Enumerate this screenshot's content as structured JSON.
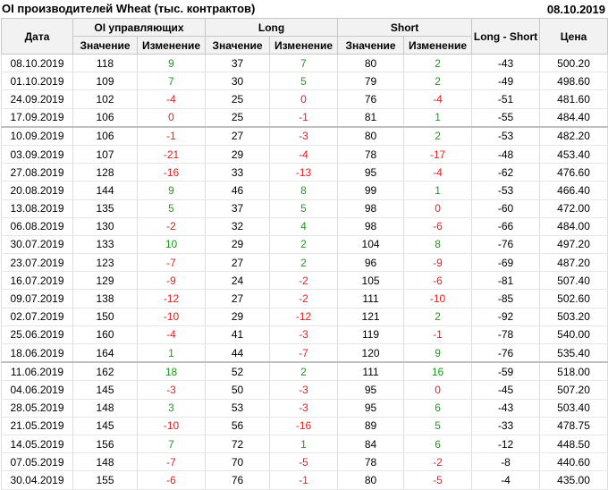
{
  "title": "OI производителей Wheat (тыс. контрактов)",
  "date": "08.10.2019",
  "headers": {
    "date": "Дата",
    "oi": "OI управляющих",
    "long": "Long",
    "short": "Short",
    "ls": "Long - Short",
    "price": "Цена",
    "value": "Значение",
    "change": "Изменение"
  },
  "colors": {
    "positive": "#1c9a1c",
    "negative": "#e02020"
  },
  "rows": [
    {
      "date": "08.10.2019",
      "oi": "118",
      "oi_ch": "9",
      "long": "37",
      "long_ch": "7",
      "short": "80",
      "short_ch": "2",
      "ls": "-43",
      "price": "500.20"
    },
    {
      "date": "01.10.2019",
      "oi": "109",
      "oi_ch": "7",
      "long": "30",
      "long_ch": "5",
      "short": "79",
      "short_ch": "2",
      "ls": "-49",
      "price": "498.60"
    },
    {
      "date": "24.09.2019",
      "oi": "102",
      "oi_ch": "-4",
      "long": "25",
      "long_ch": "0",
      "short": "76",
      "short_ch": "-4",
      "ls": "-51",
      "price": "481.60"
    },
    {
      "date": "17.09.2019",
      "oi": "106",
      "oi_ch": "0",
      "long": "25",
      "long_ch": "-1",
      "short": "81",
      "short_ch": "1",
      "ls": "-55",
      "price": "484.40"
    },
    {
      "date": "10.09.2019",
      "oi": "106",
      "oi_ch": "-1",
      "long": "27",
      "long_ch": "-3",
      "short": "80",
      "short_ch": "2",
      "ls": "-53",
      "price": "482.20",
      "sep": true
    },
    {
      "date": "03.09.2019",
      "oi": "107",
      "oi_ch": "-21",
      "long": "29",
      "long_ch": "-4",
      "short": "78",
      "short_ch": "-17",
      "ls": "-48",
      "price": "453.40"
    },
    {
      "date": "27.08.2019",
      "oi": "128",
      "oi_ch": "-16",
      "long": "33",
      "long_ch": "-13",
      "short": "95",
      "short_ch": "-4",
      "ls": "-62",
      "price": "476.60"
    },
    {
      "date": "20.08.2019",
      "oi": "144",
      "oi_ch": "9",
      "long": "46",
      "long_ch": "8",
      "short": "99",
      "short_ch": "1",
      "ls": "-53",
      "price": "466.40"
    },
    {
      "date": "13.08.2019",
      "oi": "135",
      "oi_ch": "5",
      "long": "37",
      "long_ch": "5",
      "short": "98",
      "short_ch": "0",
      "ls": "-60",
      "price": "472.00"
    },
    {
      "date": "06.08.2019",
      "oi": "130",
      "oi_ch": "-2",
      "long": "32",
      "long_ch": "4",
      "short": "98",
      "short_ch": "-6",
      "ls": "-66",
      "price": "484.00"
    },
    {
      "date": "30.07.2019",
      "oi": "133",
      "oi_ch": "10",
      "long": "29",
      "long_ch": "2",
      "short": "104",
      "short_ch": "8",
      "ls": "-76",
      "price": "497.20"
    },
    {
      "date": "23.07.2019",
      "oi": "123",
      "oi_ch": "-7",
      "long": "27",
      "long_ch": "2",
      "short": "96",
      "short_ch": "-9",
      "ls": "-69",
      "price": "487.20"
    },
    {
      "date": "16.07.2019",
      "oi": "129",
      "oi_ch": "-9",
      "long": "24",
      "long_ch": "-2",
      "short": "105",
      "short_ch": "-6",
      "ls": "-81",
      "price": "507.40"
    },
    {
      "date": "09.07.2019",
      "oi": "138",
      "oi_ch": "-12",
      "long": "27",
      "long_ch": "-2",
      "short": "111",
      "short_ch": "-10",
      "ls": "-85",
      "price": "502.60"
    },
    {
      "date": "02.07.2019",
      "oi": "150",
      "oi_ch": "-10",
      "long": "29",
      "long_ch": "-12",
      "short": "121",
      "short_ch": "2",
      "ls": "-92",
      "price": "503.20"
    },
    {
      "date": "25.06.2019",
      "oi": "160",
      "oi_ch": "-4",
      "long": "41",
      "long_ch": "-3",
      "short": "119",
      "short_ch": "-1",
      "ls": "-78",
      "price": "540.00"
    },
    {
      "date": "18.06.2019",
      "oi": "164",
      "oi_ch": "1",
      "long": "44",
      "long_ch": "-7",
      "short": "120",
      "short_ch": "9",
      "ls": "-76",
      "price": "535.40"
    },
    {
      "date": "11.06.2019",
      "oi": "162",
      "oi_ch": "18",
      "long": "52",
      "long_ch": "2",
      "short": "111",
      "short_ch": "16",
      "ls": "-59",
      "price": "518.00",
      "sep": true
    },
    {
      "date": "04.06.2019",
      "oi": "145",
      "oi_ch": "-3",
      "long": "50",
      "long_ch": "-3",
      "short": "95",
      "short_ch": "0",
      "ls": "-45",
      "price": "507.20"
    },
    {
      "date": "28.05.2019",
      "oi": "148",
      "oi_ch": "3",
      "long": "53",
      "long_ch": "-3",
      "short": "95",
      "short_ch": "6",
      "ls": "-43",
      "price": "503.40"
    },
    {
      "date": "21.05.2019",
      "oi": "145",
      "oi_ch": "-10",
      "long": "56",
      "long_ch": "-16",
      "short": "89",
      "short_ch": "5",
      "ls": "-33",
      "price": "478.75"
    },
    {
      "date": "14.05.2019",
      "oi": "156",
      "oi_ch": "7",
      "long": "72",
      "long_ch": "1",
      "short": "84",
      "short_ch": "6",
      "ls": "-12",
      "price": "448.50"
    },
    {
      "date": "07.05.2019",
      "oi": "148",
      "oi_ch": "-7",
      "long": "70",
      "long_ch": "-5",
      "short": "78",
      "short_ch": "-2",
      "ls": "-8",
      "price": "440.60"
    },
    {
      "date": "30.04.2019",
      "oi": "155",
      "oi_ch": "-6",
      "long": "76",
      "long_ch": "-1",
      "short": "80",
      "short_ch": "-5",
      "ls": "-4",
      "price": "435.00"
    }
  ]
}
